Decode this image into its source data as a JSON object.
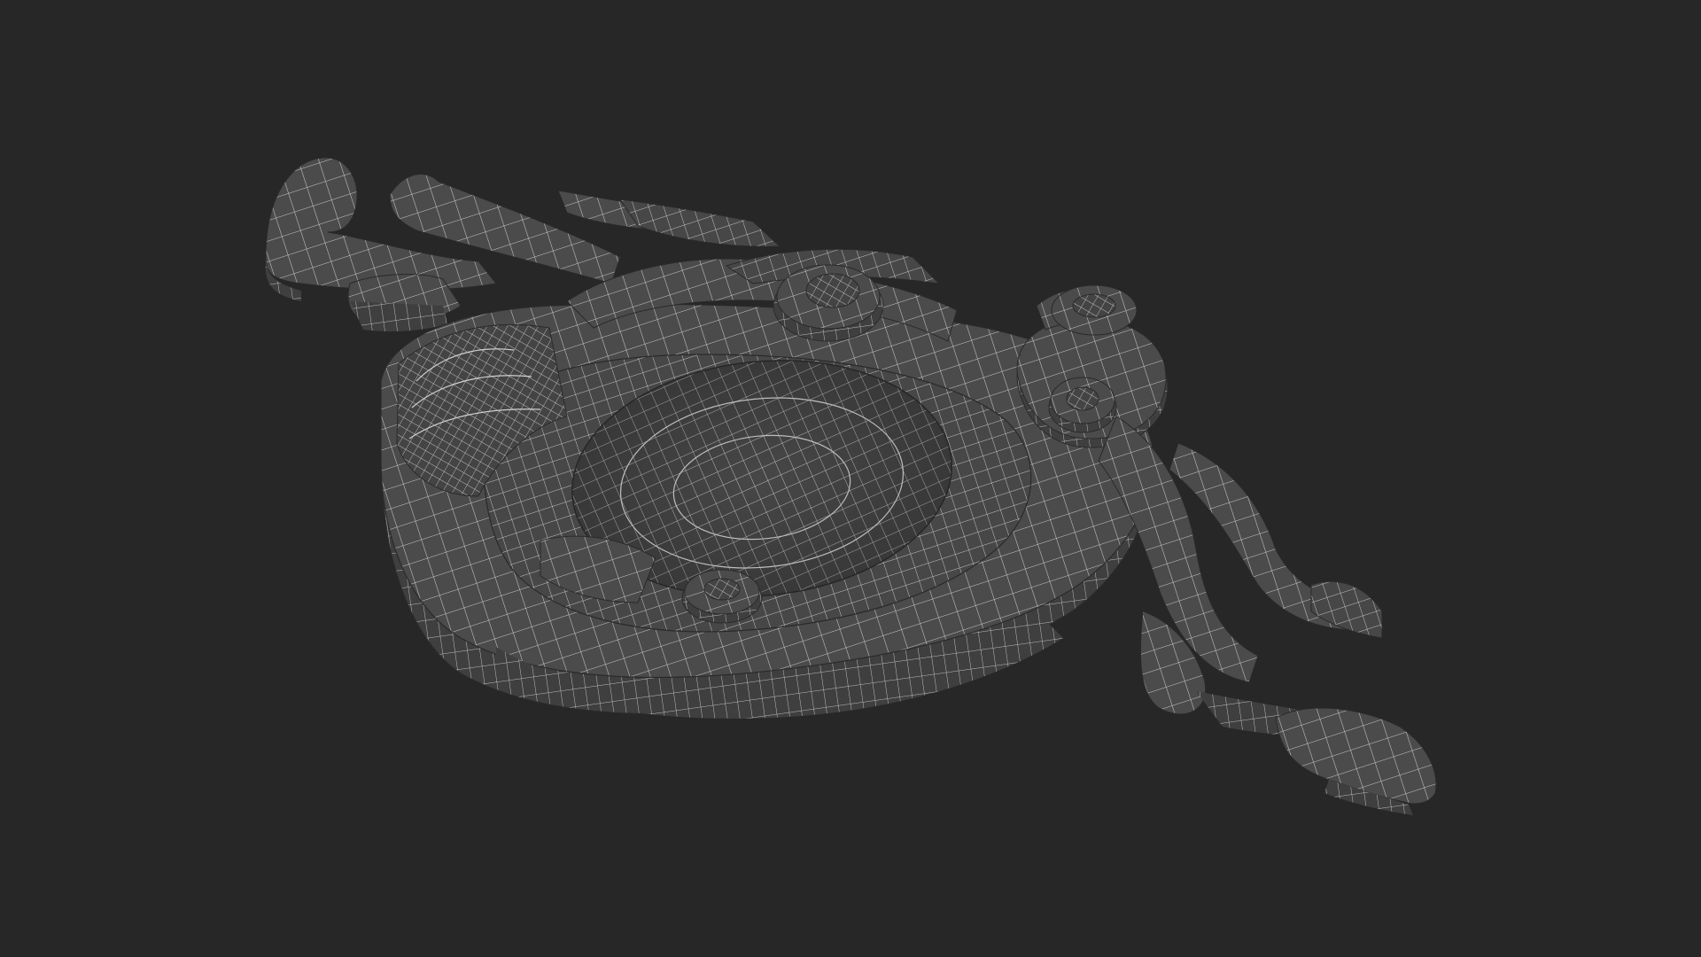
{
  "scene": {
    "subject": "wireframe-ornament-model",
    "colors": {
      "background": "#272727",
      "surface": "#4a4a4a",
      "surface_dark": "#3a3a3a",
      "surface_light": "#5c5c5c",
      "wire": "#c8c8c8"
    }
  }
}
